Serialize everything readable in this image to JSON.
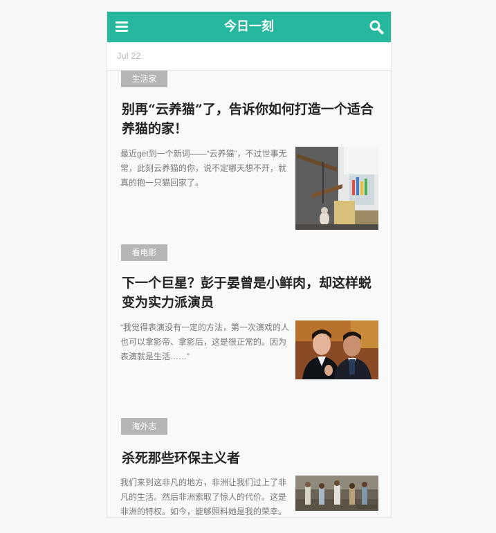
{
  "header": {
    "title": "今日一刻",
    "menu_icon": "menu-icon",
    "search_icon": "search-icon",
    "accent_color": "#25b89f"
  },
  "date_label": "Jul 22",
  "articles": [
    {
      "tag": "生活家",
      "title": "别再“云养猫”了，告诉你如何打造一个适合养猫的家！",
      "excerpt": "最近get到一个新词——“云养猫”，不过世事无常，此刻云养猫的你，说不定哪天想不开，就真的抱一只猫回家了。",
      "thumbnail": "cat-shelf-room-photo"
    },
    {
      "tag": "看电影",
      "title": "下一个巨星？彭于晏曾是小鲜肉，却这样蜕变为实力派演员",
      "excerpt": "“我觉得表演没有一定的方法，第一次演戏的人也可以拿影帝、拿影后，这是很正常的。因为表演就是生活……”",
      "thumbnail": "two-men-portrait-photo"
    },
    {
      "tag": "海外志",
      "title": "杀死那些环保主义者",
      "excerpt": "我们来到这非凡的地方，非洲让我们过上了非凡的生活。然后非洲索取了惊人的代价。这是非洲的特权。如今，能够照料她是我的荣幸。",
      "thumbnail": "africa-group-photo"
    }
  ]
}
